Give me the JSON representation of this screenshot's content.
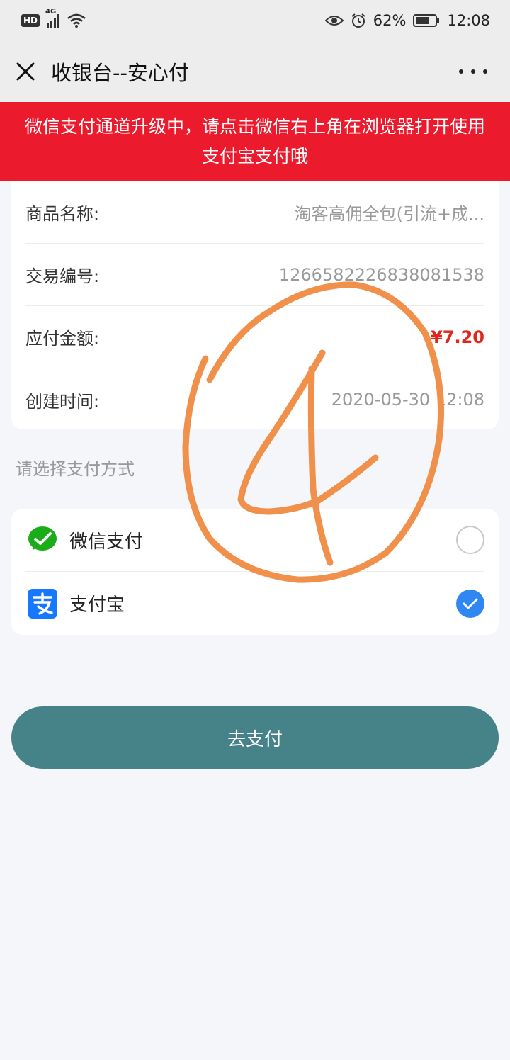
{
  "status_bar": {
    "hd": "HD",
    "network": "4G",
    "battery": "62%",
    "time": "12:08"
  },
  "header": {
    "title": "收银台--安心付"
  },
  "notice": {
    "text": "微信支付通道升级中，请点击微信右上角在浏览器打开使用支付宝支付哦"
  },
  "order": {
    "rows": [
      {
        "label": "商品名称:",
        "value": "淘客高佣全包(引流+成..."
      },
      {
        "label": "交易编号:",
        "value": "1266582226838081538"
      },
      {
        "label": "应付金额:",
        "value": "¥7.20"
      },
      {
        "label": "创建时间:",
        "value": "2020-05-30 12:08"
      }
    ]
  },
  "payment": {
    "section_label": "请选择支付方式",
    "options": [
      {
        "label": "微信支付",
        "icon": "wechat-pay-icon",
        "selected": false
      },
      {
        "label": "支付宝",
        "icon": "alipay-icon",
        "selected": true
      }
    ],
    "submit_label": "去支付"
  },
  "annotation": {
    "text": "4",
    "color": "#f0904a"
  },
  "colors": {
    "notice_bg": "#eb1b2d",
    "button_bg": "#468389",
    "amount": "#e1251b",
    "radio_checked": "#2f88f1",
    "wechat_green": "#1aad19",
    "alipay_blue": "#1677ff"
  }
}
